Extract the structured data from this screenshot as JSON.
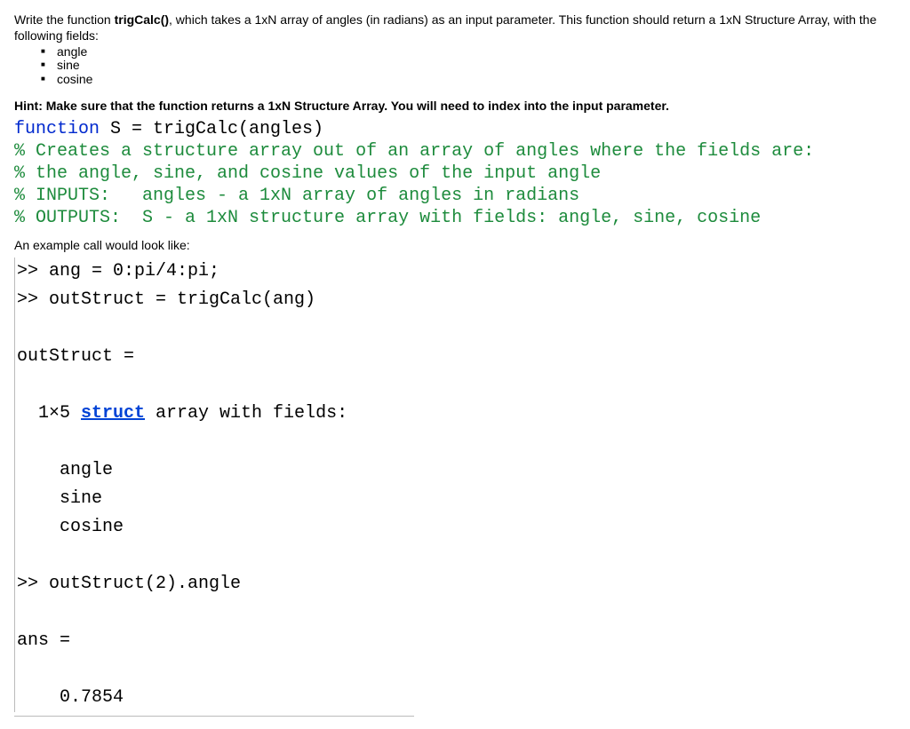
{
  "intro": {
    "pre_bold": "Write the function ",
    "func_name": "trigCalc()",
    "post_bold": ", which takes a 1xN array of angles (in radians) as an input parameter. This function should return a 1xN Structure Array, with the following fields:"
  },
  "fields": [
    "angle",
    "sine",
    "cosine"
  ],
  "hint": "Hint: Make sure that the function returns a 1xN Structure Array. You will need to index into the input parameter.",
  "code": {
    "sig_kw": "function",
    "sig_rest": " S = trigCalc(angles)",
    "c1": "% Creates a structure array out of an array of angles where the fields are:",
    "c2": "% the angle, sine, and cosine values of the input angle",
    "c3": "% INPUTS:   angles - a 1xN array of angles in radians",
    "c4": "% OUTPUTS:  S - a 1xN structure array with fields: angle, sine, cosine"
  },
  "example_label": "An example call would look like:",
  "console": {
    "l1": ">> ang = 0:pi/4:pi;",
    "l2": ">> outStruct = trigCalc(ang)",
    "l3": "",
    "l4": "outStruct =",
    "l5": "",
    "l6a": "  1×5 ",
    "l6b": "struct",
    "l6c": " array with fields:",
    "l7": "",
    "l8": "    angle",
    "l9": "    sine",
    "l10": "    cosine",
    "l11": "",
    "l12": ">> outStruct(2).angle",
    "l13": "",
    "l14": "ans =",
    "l15": "",
    "l16": "    0.7854"
  }
}
